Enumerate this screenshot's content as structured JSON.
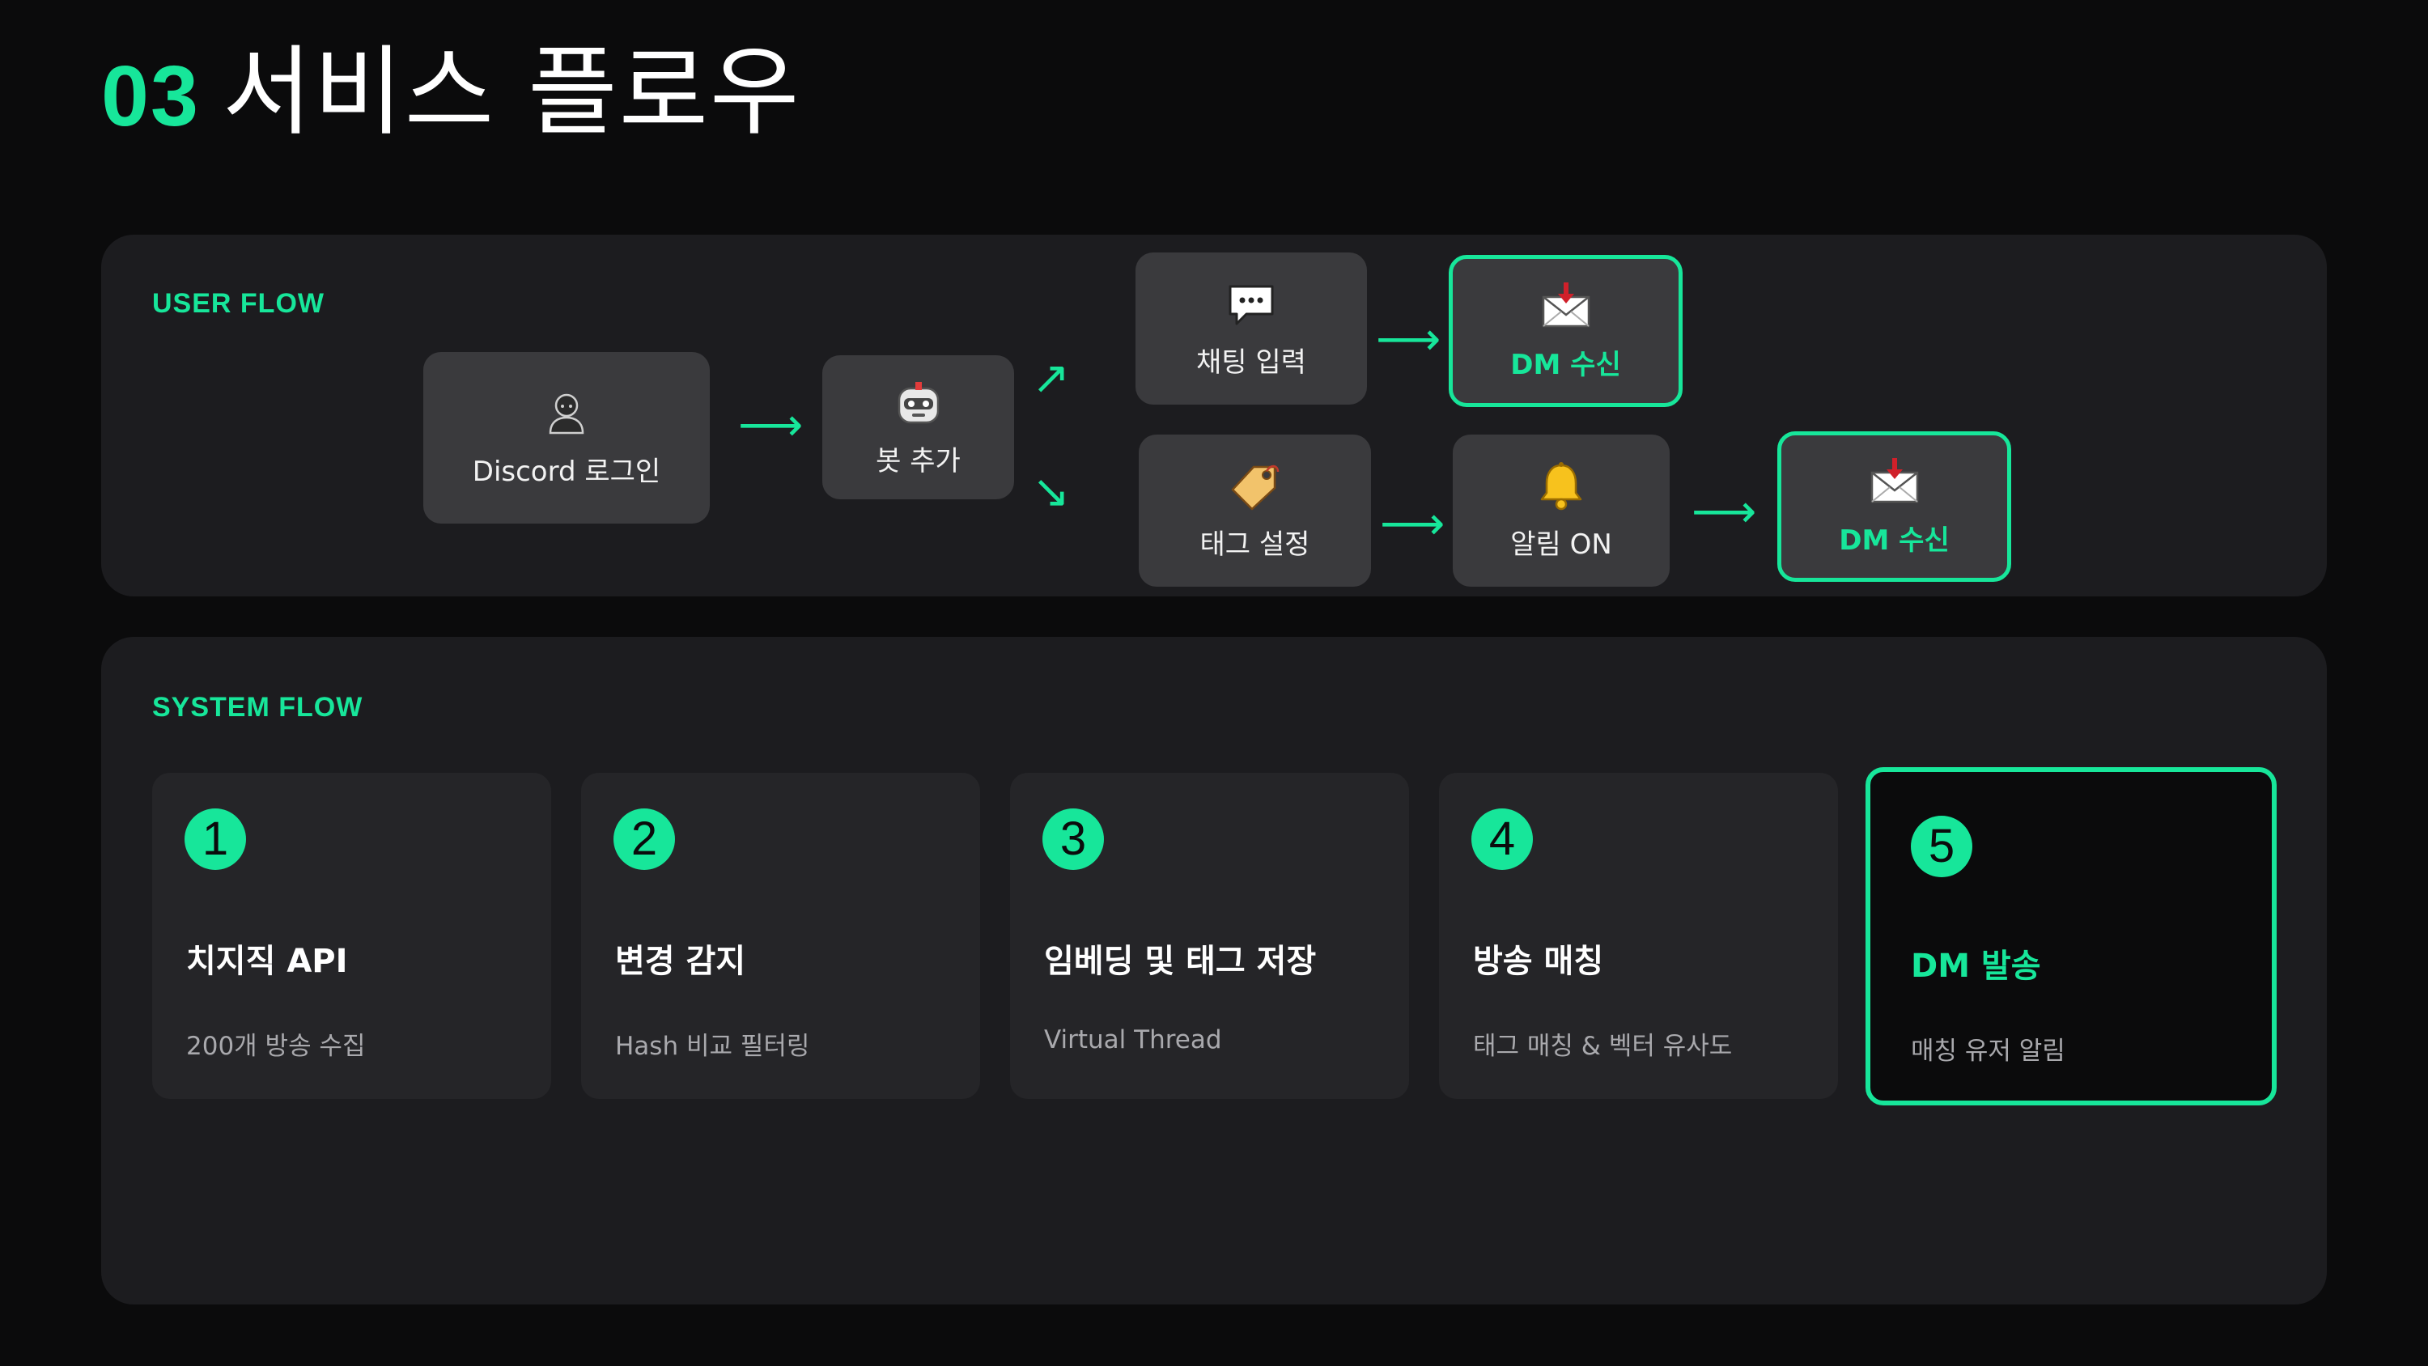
{
  "header": {
    "number": "03",
    "title": "서비스 플로우"
  },
  "user_flow": {
    "label": "USER FLOW",
    "nodes": {
      "login": {
        "label": "Discord 로그인",
        "icon": "user-icon"
      },
      "bot": {
        "label": "봇 추가",
        "icon": "robot-icon"
      },
      "chat": {
        "label": "채팅 입력",
        "icon": "speech-bubble-icon"
      },
      "dm_top": {
        "label": "DM 수신",
        "icon": "envelope-icon"
      },
      "tag": {
        "label": "태그 설정",
        "icon": "tag-icon"
      },
      "alarm": {
        "label": "알림 ON",
        "icon": "bell-icon"
      },
      "dm_bottom": {
        "label": "DM 수신",
        "icon": "envelope-icon"
      }
    },
    "arrows": {
      "right": "⟶",
      "up_right": "↗",
      "down_right": "↘"
    }
  },
  "system_flow": {
    "label": "SYSTEM FLOW",
    "steps": [
      {
        "number": "1",
        "title": "치지직 API",
        "desc": "200개 방송 수집"
      },
      {
        "number": "2",
        "title": "변경 감지",
        "desc": "Hash 비교 필터링"
      },
      {
        "number": "3",
        "title": "임베딩 및 태그 저장",
        "desc": "Virtual Thread"
      },
      {
        "number": "4",
        "title": "방송 매칭",
        "desc": "태그 매칭 & 벡터 유사도"
      },
      {
        "number": "5",
        "title": "DM 발송",
        "desc": "매칭 유저 알림"
      }
    ]
  },
  "colors": {
    "accent": "#17e69a",
    "background": "#0b0b0c",
    "panel": "#1c1c1f",
    "node": "#3a3a3d",
    "card": "#252528"
  }
}
